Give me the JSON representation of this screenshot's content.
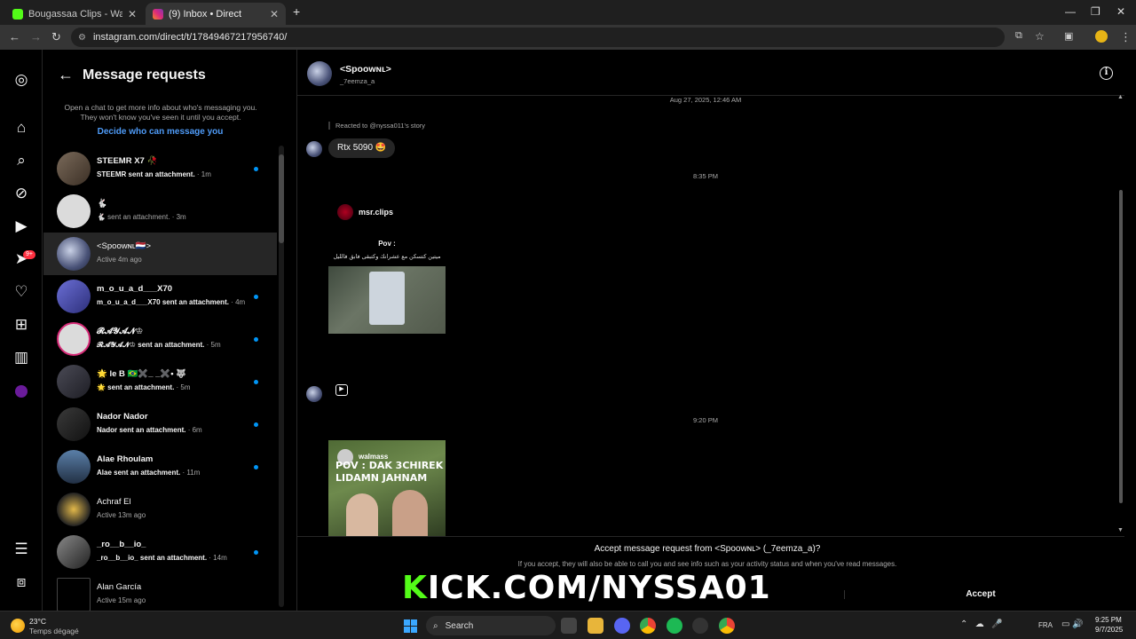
{
  "browser": {
    "tabs": [
      {
        "label": "Bougassaa Clips - Watch Live o",
        "favicon_color": "#53fc18"
      },
      {
        "label": "(9) Inbox • Direct",
        "favicon_color": "#e1306c"
      }
    ],
    "url": "instagram.com/direct/t/17849467217956740/",
    "new_tab": "+",
    "close": "✕"
  },
  "rail": {
    "notifications_badge": "9+"
  },
  "requests": {
    "title": "Message requests",
    "info": "Open a chat to get more info about who's messaging you. They won't know you've seen it until you accept.",
    "link": "Decide who can message you",
    "items": [
      {
        "name": "STEEMR X7 🥀",
        "sub": "STEEMR sent an attachment.",
        "time": "· 1m",
        "unread": true,
        "bold": true
      },
      {
        "name": "🐇",
        "sub": "🐇 sent an attachment.",
        "time": "· 3m",
        "unread": false,
        "bold": false
      },
      {
        "name": "<Spoowɴʟ🇳🇱>",
        "sub": "Active 4m ago",
        "time": "",
        "unread": false,
        "bold": false,
        "active": true
      },
      {
        "name": "m_o_u_a_d___X70",
        "sub": "m_o_u_a_d___X70 sent an attachment.",
        "time": "· 4m",
        "unread": true,
        "bold": true
      },
      {
        "name": "𝓡𝓐𝓨𝓐𝓝♔",
        "sub": "𝓡𝓐𝓨𝓐𝓝♔ sent an attachment.",
        "time": "· 5m",
        "unread": true,
        "bold": true
      },
      {
        "name": "🌟 le B 🇧🇷✖️_ _✖️• 🐺",
        "sub": "🌟 sent an attachment.",
        "time": "· 5m",
        "unread": true,
        "bold": true
      },
      {
        "name": "Nador Nador",
        "sub": "Nador sent an attachment.",
        "time": "· 6m",
        "unread": true,
        "bold": true
      },
      {
        "name": "Alae Rhoulam",
        "sub": "Alae sent an attachment.",
        "time": "· 11m",
        "unread": true,
        "bold": true
      },
      {
        "name": "Achraf El",
        "sub": "Active 13m ago",
        "time": "",
        "unread": false,
        "bold": false
      },
      {
        "name": "_ro__b__io_",
        "sub": "_ro__b__io_ sent an attachment.",
        "time": "· 14m",
        "unread": true,
        "bold": true
      },
      {
        "name": "Alan García",
        "sub": "Active 15m ago",
        "time": "",
        "unread": false,
        "bold": false
      }
    ]
  },
  "chat": {
    "name": "<Spoowɴʟ>",
    "username": "_7eemza_a",
    "timestamp1": "Aug 27, 2025, 12:46 AM",
    "reacted": "Reacted to @nyssa011's story",
    "bubble": "Rtx 5090 🤩",
    "timestamp2": "8:35 PM",
    "share1_user": "msr.clips",
    "share1_pov": "Pov :",
    "share1_caption": "ميتين كتسكن مع عشرانك وكتبقى فابق فالليل",
    "timestamp3": "9:20 PM",
    "share2_user": "walmass",
    "share2_line1": "POV : DAK 3CHIREK",
    "share2_line2": "LIDAMN JAHNAM",
    "accept_title": "Accept message request from <Spoowɴʟ> (_7eemza_a)?",
    "accept_desc": "If you accept, they will also be able to call you and see info such as your activity status and when you've read messages.",
    "accept_button": "Accept"
  },
  "overlay": {
    "kick_k": "K",
    "kick_rest": "ICK.COM/NYSSA01"
  },
  "taskbar": {
    "temp": "23°C",
    "weather": "Temps dégagé",
    "search": "Search",
    "lang": "FRA",
    "time": "9:25 PM",
    "date": "9/7/2025"
  },
  "colors": {
    "accent_blue": "#0095f6",
    "link_blue": "#4f9cf9",
    "kick_green": "#53fc18"
  }
}
